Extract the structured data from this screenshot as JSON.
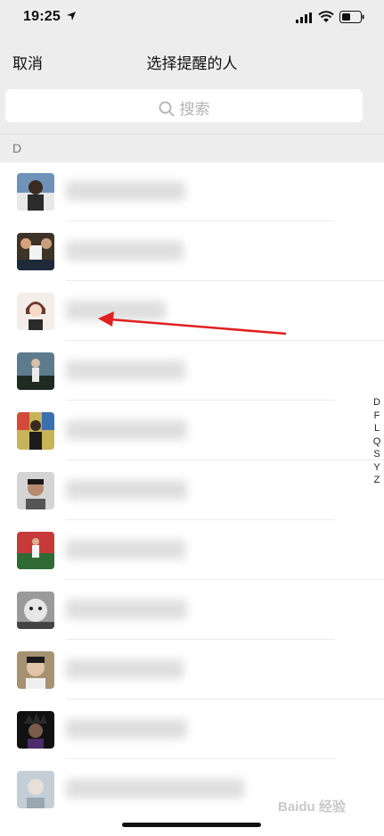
{
  "status_bar": {
    "time": "19:25"
  },
  "nav": {
    "cancel_label": "取消",
    "title": "选择提醒的人"
  },
  "search": {
    "placeholder": "搜索"
  },
  "section": {
    "letter": "D"
  },
  "contacts": [
    {
      "name": "",
      "avatar_color": "#6b8fb3"
    },
    {
      "name": "",
      "avatar_color": "#5a4a3d"
    },
    {
      "name": "",
      "avatar_color": "#e7dcd6"
    },
    {
      "name": "",
      "avatar_color": "#4b6b57"
    },
    {
      "name": "",
      "avatar_color": "#6e7c56"
    },
    {
      "name": "",
      "avatar_color": "#c5c5c5"
    },
    {
      "name": "",
      "avatar_color": "#3c6a3a"
    },
    {
      "name": "",
      "avatar_color": "#8d8d8d"
    },
    {
      "name": "",
      "avatar_color": "#9c8a6a"
    },
    {
      "name": "",
      "avatar_color": "#141414"
    },
    {
      "name": "",
      "avatar_color": "#b9c4cc"
    }
  ],
  "index": [
    "D",
    "F",
    "L",
    "Q",
    "S",
    "Y",
    "Z"
  ],
  "watermark": "Baidu 经验",
  "colors": {
    "background": "#ededed",
    "annotation_arrow": "#e02020"
  }
}
